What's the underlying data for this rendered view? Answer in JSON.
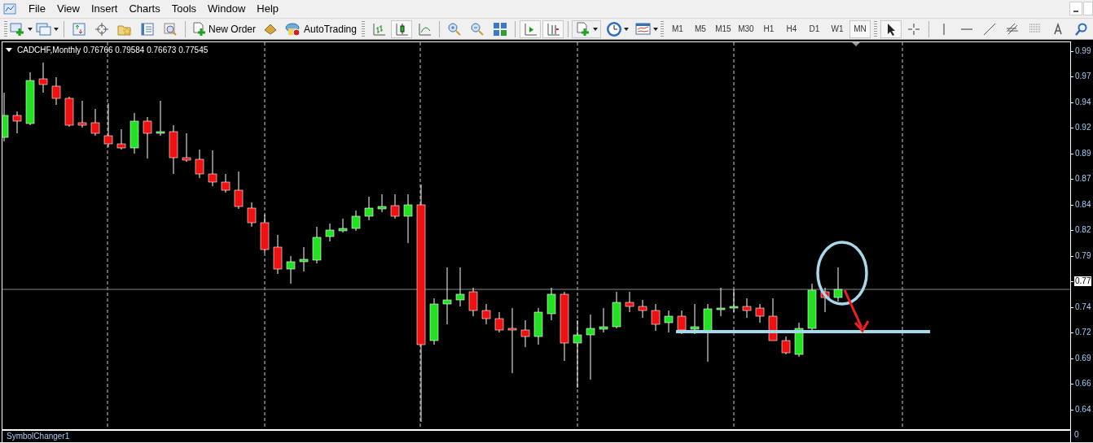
{
  "menu": [
    "File",
    "View",
    "Insert",
    "Charts",
    "Tools",
    "Window",
    "Help"
  ],
  "toolbar": {
    "new_order": "New Order",
    "autotrading": "AutoTrading",
    "chart_types": [
      {
        "kind": "bar",
        "selected": false
      },
      {
        "kind": "candle",
        "selected": true
      },
      {
        "kind": "line",
        "selected": false
      }
    ],
    "chart_shift": true,
    "auto_scroll": true,
    "timeframes": [
      {
        "label": "M1",
        "selected": false
      },
      {
        "label": "M5",
        "selected": false
      },
      {
        "label": "M15",
        "selected": false
      },
      {
        "label": "M30",
        "selected": false
      },
      {
        "label": "H1",
        "selected": false
      },
      {
        "label": "H4",
        "selected": false
      },
      {
        "label": "D1",
        "selected": false
      },
      {
        "label": "W1",
        "selected": false
      },
      {
        "label": "MN",
        "selected": true
      }
    ],
    "tools": [
      {
        "kind": "cursor",
        "selected": true
      },
      {
        "kind": "crosshair",
        "selected": false
      },
      {
        "kind": "vline",
        "selected": false
      },
      {
        "kind": "hline",
        "selected": false
      },
      {
        "kind": "trendline",
        "selected": false
      },
      {
        "kind": "channel",
        "selected": false
      },
      {
        "kind": "fibo",
        "selected": false
      },
      {
        "kind": "text",
        "selected": false
      },
      {
        "kind": "search",
        "selected": false
      }
    ]
  },
  "chart": {
    "title": "CADCHF,Monthly",
    "ohlc": "0.76766 0.79584 0.76673 0.77545",
    "price_labels": [
      {
        "kind": "tick",
        "text": "0.99"
      },
      {
        "kind": "tick",
        "text": "0.97"
      },
      {
        "kind": "tick",
        "text": "0.94"
      },
      {
        "kind": "tick",
        "text": "0.92"
      },
      {
        "kind": "tick",
        "text": "0.89"
      },
      {
        "kind": "tick",
        "text": "0.87"
      },
      {
        "kind": "tick",
        "text": "0.84"
      },
      {
        "kind": "tick",
        "text": "0.82"
      },
      {
        "kind": "tick",
        "text": "0.79"
      },
      {
        "kind": "current",
        "text": "0.77"
      },
      {
        "kind": "tick",
        "text": "0.74"
      },
      {
        "kind": "tick",
        "text": "0.72"
      },
      {
        "kind": "tick",
        "text": "0.69"
      },
      {
        "kind": "tick",
        "text": "0.66"
      },
      {
        "kind": "tick",
        "text": "0.64"
      }
    ]
  },
  "subwindow": {
    "title": "SymbolChanger1",
    "axis_label": "0"
  }
}
